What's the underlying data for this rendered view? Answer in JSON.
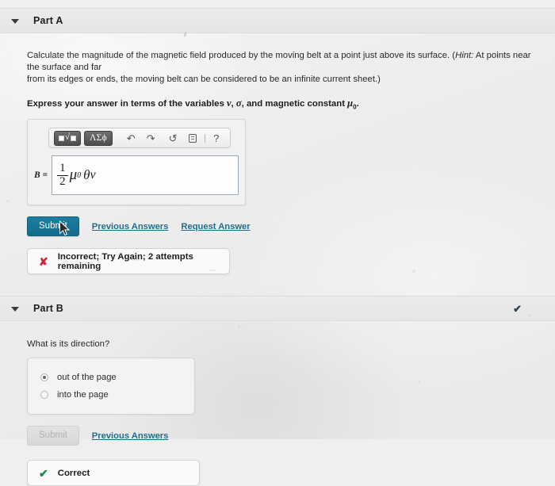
{
  "parts": {
    "a": {
      "title": "Part A",
      "question_line1": "Calculate the magnitude of the magnetic field produced by the moving belt at a point just above its surface. (",
      "hint_label": "Hint:",
      "question_line1b": " At points near the surface and far",
      "question_line2": "from its edges or ends, the moving belt can be considered to be an infinite current sheet.)",
      "instruction_pre": "Express your answer in terms of the variables ",
      "instruction_var1": "v",
      "instruction_mid": ", ",
      "instruction_var2": "σ",
      "instruction_post": ", and magnetic constant ",
      "instruction_const": "μ",
      "instruction_const_sub": "0",
      "instruction_end": ".",
      "answer": {
        "label": "B =",
        "numerator": "1",
        "denominator": "2",
        "mu": "μ",
        "mu_sub": "0",
        "theta": "θ",
        "v": "v"
      },
      "toolbar": {
        "template_button": "template-sqrt",
        "radical_glyph": "√",
        "greek_button": "ΛΣϕ",
        "undo_glyph": "↶",
        "redo_glyph": "↷",
        "reset_glyph": "↺",
        "keyboard_label": "keyboard",
        "help_glyph": "?"
      },
      "submit_label": "Submit",
      "previous_answers_label": "Previous Answers",
      "request_answer_label": "Request Answer",
      "feedback": {
        "icon": "✘",
        "text": "Incorrect; Try Again; 2 attempts remaining"
      }
    },
    "b": {
      "title": "Part B",
      "header_check": "✔",
      "question": "What is its direction?",
      "choices": [
        {
          "label": "out of the page",
          "selected": true
        },
        {
          "label": "into the page",
          "selected": false
        }
      ],
      "submit_label": "Submit",
      "submit_disabled": true,
      "previous_answers_label": "Previous Answers",
      "feedback": {
        "icon": "✔",
        "text": "Correct"
      }
    }
  },
  "colors": {
    "submit_blue": "#1b7fa0",
    "link_blue": "#1e6e8c",
    "incorrect_red": "#cf2640",
    "correct_green": "#1e8a4c",
    "page_bg": "#efefef"
  }
}
